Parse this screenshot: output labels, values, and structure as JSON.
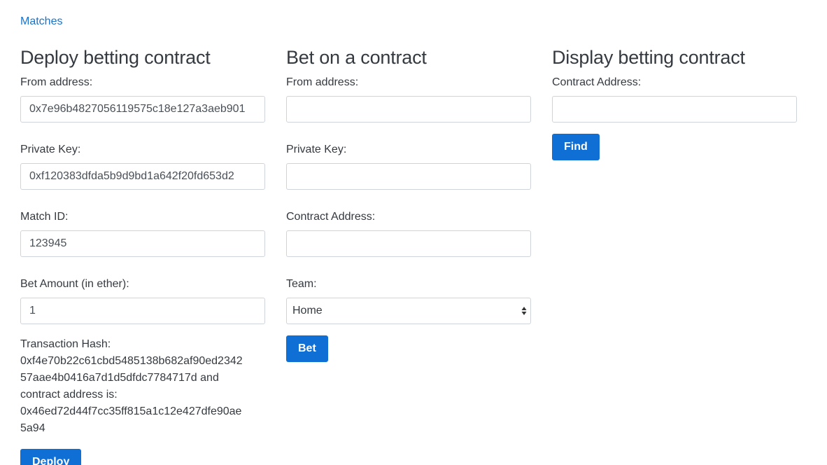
{
  "nav": {
    "matches_link": "Matches"
  },
  "deploy": {
    "title": "Deploy betting contract",
    "from_label": "From address:",
    "from_value": "0x7e96b4827056119575c18e127a3aeb901",
    "key_label": "Private Key:",
    "key_value": "0xf120383dfda5b9d9bd1a642f20fd653d2",
    "match_label": "Match ID:",
    "match_value": "123945",
    "amount_label": "Bet Amount (in ether):",
    "amount_value": "1",
    "tx_lines": [
      "Transaction Hash:",
      "0xf4e70b22c61cbd5485138b682af90ed2342",
      "57aae4b0416a7d1d5dfdc7784717d and",
      "contract address is:",
      "0x46ed72d44f7cc35ff815a1c12e427dfe90ae",
      "5a94"
    ],
    "button": "Deploy"
  },
  "bet": {
    "title": "Bet on a contract",
    "from_label": "From address:",
    "from_value": "",
    "key_label": "Private Key:",
    "key_value": "",
    "contract_label": "Contract Address:",
    "contract_value": "",
    "team_label": "Team:",
    "team_value": "Home",
    "button": "Bet"
  },
  "display": {
    "title": "Display betting contract",
    "contract_label": "Contract Address:",
    "contract_value": "",
    "button": "Find"
  },
  "colors": {
    "link": "#1a73c9",
    "button": "#0f6fd4",
    "text": "#343a40",
    "border": "#ced4da"
  }
}
